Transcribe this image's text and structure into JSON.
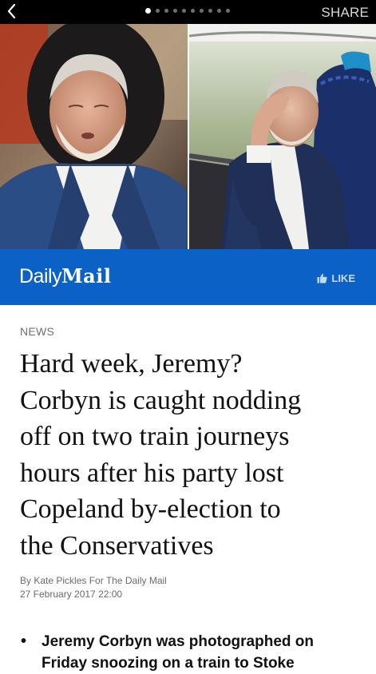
{
  "topbar": {
    "back_icon": "chevron-left-icon",
    "share_label": "SHARE",
    "page_indicator": {
      "total": 10,
      "current": 1
    }
  },
  "gallery": {
    "photos": [
      {
        "icon": "photo-corbyn-asleep-headrest"
      },
      {
        "icon": "photo-corbyn-hand-on-forehead-train-window"
      }
    ]
  },
  "brand": {
    "logo_word1": "Daily",
    "logo_word2": "Mail",
    "like_label": "LIKE",
    "like_icon": "thumbs-up-icon",
    "color": "#0b61c5"
  },
  "article": {
    "category": "NEWS",
    "headline_lines": [
      "Hard week, Jeremy?",
      "Corbyn is caught nodding",
      "off on two train journeys",
      "hours after his party lost",
      "Copeland by-election to",
      "the Conservatives"
    ],
    "byline": "By Kate Pickles For The Daily Mail",
    "date": "27 February 2017 22:00",
    "bullets": [
      "Jeremy Corbyn was photographed on Friday snoozing on a train to Stoke"
    ]
  }
}
